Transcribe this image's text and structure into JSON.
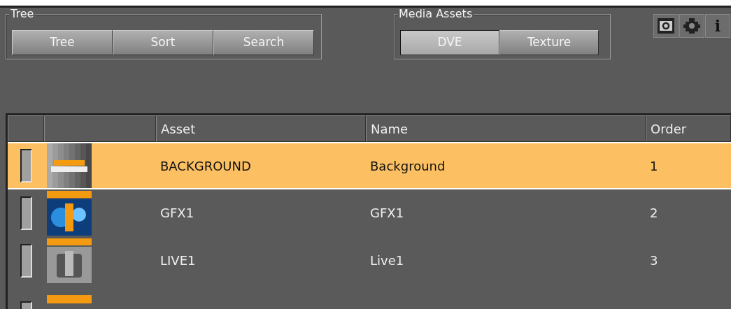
{
  "groups": [
    {
      "title": "Tree",
      "buttons": [
        {
          "label": "Tree",
          "selected": false
        },
        {
          "label": "Sort",
          "selected": false
        },
        {
          "label": "Search",
          "selected": false
        }
      ]
    },
    {
      "title": "Media Assets",
      "buttons": [
        {
          "label": "DVE",
          "selected": true
        },
        {
          "label": "Texture",
          "selected": false
        }
      ]
    }
  ],
  "toolbar": [
    {
      "kind": "film"
    },
    {
      "kind": "puzzle"
    },
    {
      "kind": "info",
      "label": "i"
    }
  ],
  "table": {
    "columns": [
      "Asset",
      "Name",
      "Order"
    ],
    "rows": [
      {
        "asset": "BACKGROUND",
        "name": "Background",
        "order": "1",
        "selected": true
      },
      {
        "asset": "GFX1",
        "name": "GFX1",
        "order": "2",
        "selected": false
      },
      {
        "asset": "LIVE1",
        "name": "Live1",
        "order": "3",
        "selected": false
      },
      {
        "selected": false
      }
    ]
  }
}
